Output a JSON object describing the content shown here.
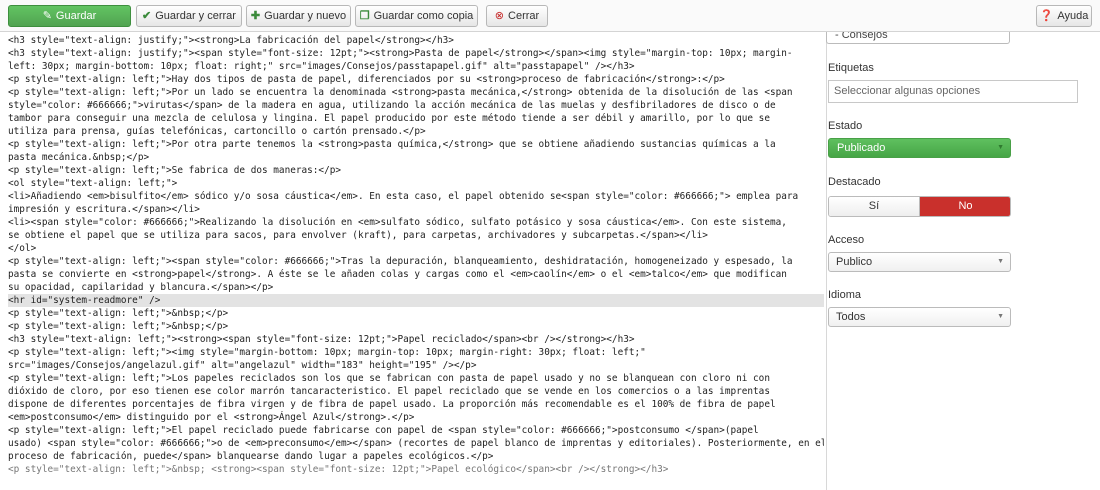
{
  "toolbar": {
    "save": "Guardar",
    "save_close": "Guardar y cerrar",
    "save_new": "Guardar y nuevo",
    "save_copy": "Guardar como copia",
    "close": "Cerrar",
    "help": "Ayuda"
  },
  "editor": {
    "lines": [
      "<h3 style=\"text-align: justify;\"><strong>La fabricación del papel</strong></h3>",
      "<h3 style=\"text-align: justify;\"><span style=\"font-size: 12pt;\"><strong>Pasta de papel</strong></span><img style=\"margin-top: 10px; margin-",
      "left: 30px; margin-bottom: 10px; float: right;\" src=\"images/Consejos/passtapapel.gif\" alt=\"passtapapel\" /></h3>",
      "<p style=\"text-align: left;\">Hay dos tipos de pasta de papel, diferenciados por su <strong>proceso de fabricación</strong>:</p>",
      "<p style=\"text-align: left;\">Por un lado se encuentra la denominada <strong>pasta mecánica,</strong> obtenida de la disolución de las <span",
      "style=\"color: #666666;\">virutas</span> de la madera en agua, utilizando la acción mecánica de las muelas y desfibriladores de disco o de",
      "tambor para conseguir una mezcla de celulosa y lingina. El papel producido por este método tiende a ser débil y amarillo, por lo que se",
      "utiliza para prensa, guías telefónicas, cartoncillo o cartón prensado.</p>",
      "<p style=\"text-align: left;\">Por otra parte tenemos la <strong>pasta química,</strong> que se obtiene añadiendo sustancias químicas a la",
      "pasta mecánica.&nbsp;</p>",
      "<p style=\"text-align: left;\">Se fabrica de dos maneras:</p>",
      "<ol style=\"text-align: left;\">",
      "<li>Añadiendo <em>bisulfito</em> sódico y/o sosa cáustica</em>. En esta caso, el papel obtenido se<span style=\"color: #666666;\"> emplea para",
      "impresión y escritura.</span></li>",
      "<li><span style=\"color: #666666;\">Realizando la disolución en <em>sulfato sódico, sulfato potásico y sosa cáustica</em>. Con este sistema,",
      "se obtiene el papel que se utiliza para sacos, para envolver (kraft), para carpetas, archivadores y subcarpetas.</span></li>",
      "</ol>",
      "<p style=\"text-align: left;\"><span style=\"color: #666666;\">Tras la depuración, blanqueamiento, deshidratación, homogeneizado y espesado, la",
      "pasta se convierte en <strong>papel</strong>. A éste se le añaden colas y cargas como el <em>caolín</em> o el <em>talco</em> que modifican",
      "su opacidad, capilaridad y blancura.</span></p>",
      "<hr id=\"system-readmore\" />",
      "<p style=\"text-align: left;\">&nbsp;</p>",
      "<p style=\"text-align: left;\">&nbsp;</p>",
      "<h3 style=\"text-align: left;\"><strong><span style=\"font-size: 12pt;\">Papel reciclado</span><br /></strong></h3>",
      "<p style=\"text-align: left;\"><img style=\"margin-bottom: 10px; margin-top: 10px; margin-right: 30px; float: left;\"",
      "src=\"images/Consejos/angelazul.gif\" alt=\"angelazul\" width=\"183\" height=\"195\" /></p>",
      "<p style=\"text-align: left;\">Los papeles reciclados son los que se fabrican con pasta de papel usado y no se blanquean con cloro ni con",
      "dióxido de cloro, por eso tienen ese color marrón tancaracteristico. El papel reciclado que se vende en los comercios o a las imprentas",
      "dispone de diferentes porcentajes de fibra virgen y de fibra de papel usado. La proporción más recomendable es el 100% de fibra de papel",
      "<em>postconsumo</em> distinguido por el <strong>Ángel Azul</strong>.</p>",
      "<p style=\"text-align: left;\">El papel reciclado puede fabricarse con papel de <span style=\"color: #666666;\">postconsumo </span>(papel",
      "usado) <span style=\"color: #666666;\">o de <em>preconsumo</em></span> (recortes de papel blanco de imprentas y editoriales). Posteriormente, en el",
      "proceso de fabricación, puede</span> blanquearse dando lugar a papeles ecológicos.</p>",
      "<p style=\"text-align: left;\">&nbsp; <strong><span style=\"font-size: 12pt;\">Papel ecológico</span><br /></strong></h3>"
    ]
  },
  "sidebar": {
    "category_value": "- Consejos",
    "tags_label": "Etiquetas",
    "tags_placeholder": "Seleccionar algunas opciones",
    "state_label": "Estado",
    "state_value": "Publicado",
    "featured_label": "Destacado",
    "featured_yes": "Sí",
    "featured_no": "No",
    "access_label": "Acceso",
    "access_value": "Publico",
    "language_label": "Idioma",
    "language_value": "Todos"
  },
  "colors": {
    "save_green": "#5cb85c",
    "state_green": "#52ad52",
    "no_red": "#c9302c",
    "highlight_line": "#e3e3e3"
  },
  "icons": [
    "edit-icon",
    "check-icon",
    "plus-icon",
    "copy-icon",
    "close-circle-icon",
    "help-icon",
    "chevron-down-icon"
  ]
}
